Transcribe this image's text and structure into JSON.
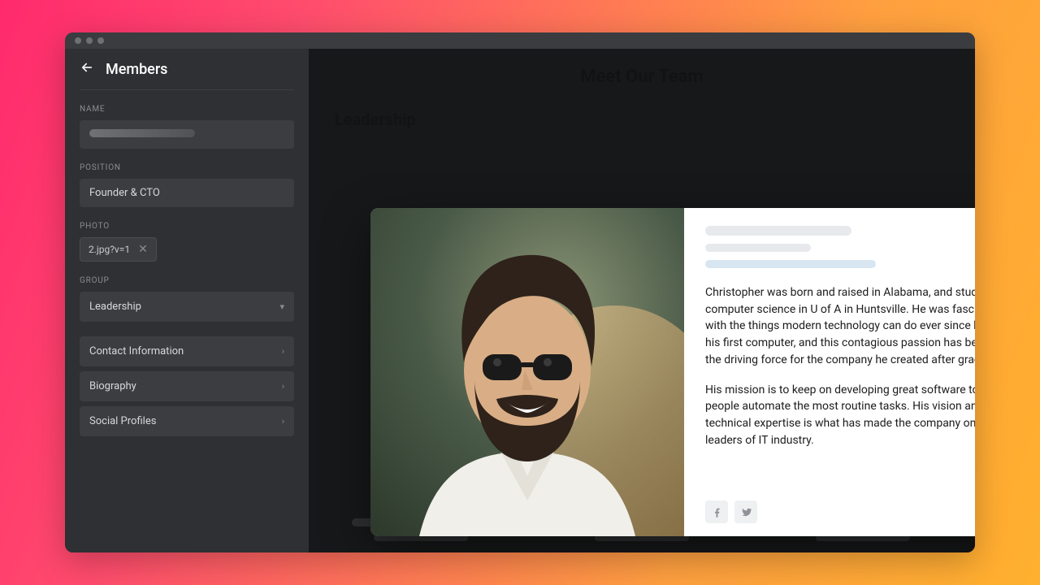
{
  "sidebar": {
    "title": "Members",
    "labels": {
      "name": "NAME",
      "position": "POSITION",
      "photo": "PHOTO",
      "group": "GROUP"
    },
    "name_value": "",
    "position_value": "Founder & CTO",
    "photo_chip": "2.jpg?v=1",
    "group_value": "Leadership",
    "accordion": {
      "contact": "Contact Information",
      "bio": "Biography",
      "social": "Social Profiles"
    }
  },
  "canvas": {
    "page_title": "Meet Our Team",
    "section_title": "Leadership"
  },
  "modal": {
    "bio_p1": "Christopher was born and raised in Alabama, and studied computer science in U of A in Huntsville. He was fascinated with the things modern technology can do ever since he's got his first computer, and this contagious passion has become the driving force for the company he created after graduation.",
    "bio_p2": "His mission is to keep on developing great software to help people automate the most routine tasks. His vision and technical expertise is what has made the company one of the leaders of IT industry."
  }
}
